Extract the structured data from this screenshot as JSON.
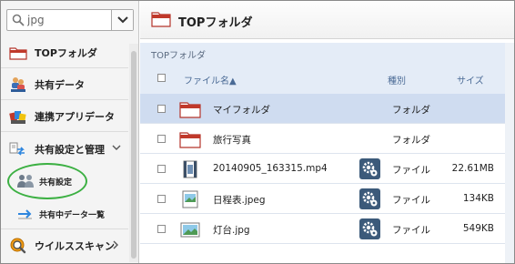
{
  "search": {
    "value": "jpg",
    "placeholder": "jpg"
  },
  "sidebar": {
    "items": [
      {
        "label": "TOPフォルダ"
      },
      {
        "label": "共有データ"
      },
      {
        "label": "連携アプリデータ"
      },
      {
        "label": "共有設定と管理"
      },
      {
        "label": "共有設定"
      },
      {
        "label": "共有中データ一覧"
      },
      {
        "label": "ウイルススキャン"
      }
    ]
  },
  "main": {
    "title": "TOPフォルダ",
    "breadcrumb": "TOPフォルダ",
    "columns": {
      "name": "ファイル名▲",
      "kind": "種別",
      "size": "サイズ"
    },
    "rows": [
      {
        "name": "マイフォルダ",
        "kind": "フォルダ",
        "size": ""
      },
      {
        "name": "旅行写真",
        "kind": "フォルダ",
        "size": ""
      },
      {
        "name": "20140905_163315.mp4",
        "kind": "ファイル",
        "size": "22.61MB"
      },
      {
        "name": "日程表.jpeg",
        "kind": "ファイル",
        "size": "134KB"
      },
      {
        "name": "灯台.jpg",
        "kind": "ファイル",
        "size": "549KB"
      }
    ]
  },
  "colors": {
    "accent": "#3cb043",
    "header_blue": "#e4ecf7",
    "selected_row": "#cfdcf0",
    "gear_button": "#3c5a7a",
    "folder_red": "#c0392b"
  },
  "icons": {
    "search": "search-icon",
    "dropdown": "chevron-down-icon",
    "top_folder": "folder-icon",
    "shared_data": "people-icon",
    "linked_apps": "apps-icon",
    "share_manage": "share-arrows-icon",
    "share_settings": "users-icon",
    "shared_list": "arrow-right-icon",
    "virus_scan": "shield-magnifier-icon",
    "video": "film-icon",
    "image": "image-icon",
    "file_menu": "gear-icon"
  }
}
